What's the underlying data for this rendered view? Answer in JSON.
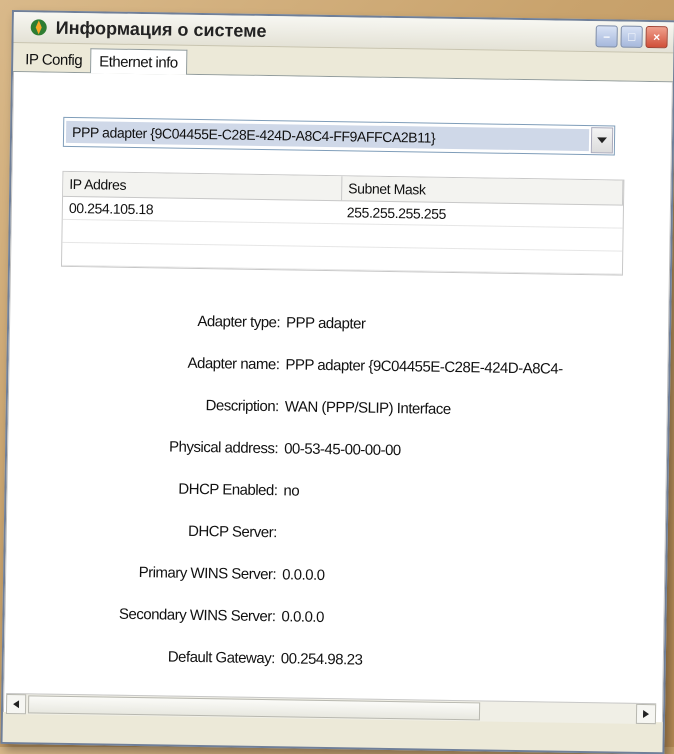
{
  "window": {
    "title": "Информация о системе",
    "controls": [
      "minimize",
      "maximize",
      "close"
    ]
  },
  "tabs": [
    {
      "label": "IP Config",
      "active": false
    },
    {
      "label": "Ethernet info",
      "active": true
    }
  ],
  "adapter_select": {
    "selected": "PPP adapter {9C04455E-C28E-424D-A8C4-FF9AFFCA2B11}"
  },
  "ip_table": {
    "columns": [
      "IP Addres",
      "Subnet Mask"
    ],
    "rows": [
      [
        "00.254.105.18",
        "255.255.255.255"
      ]
    ]
  },
  "properties": [
    {
      "label": "Adapter type:",
      "value": "PPP adapter"
    },
    {
      "label": "Adapter name:",
      "value": "PPP adapter {9C04455E-C28E-424D-A8C4-"
    },
    {
      "label": "Description:",
      "value": "WAN (PPP/SLIP) Interface"
    },
    {
      "label": "Physical address:",
      "value": "00-53-45-00-00-00"
    },
    {
      "label": "DHCP Enabled:",
      "value": "no"
    },
    {
      "label": "DHCP Server:",
      "value": ""
    },
    {
      "label": "Primary WINS Server:",
      "value": "0.0.0.0"
    },
    {
      "label": "Secondary WINS Server:",
      "value": "0.0.0.0"
    },
    {
      "label": "Default Gateway:",
      "value": "00.254.98.23"
    }
  ],
  "icons": {
    "app": "app-icon",
    "combo_arrow": "chevron-down-icon",
    "scroll_left": "arrow-left-icon",
    "scroll_right": "arrow-right-icon"
  }
}
